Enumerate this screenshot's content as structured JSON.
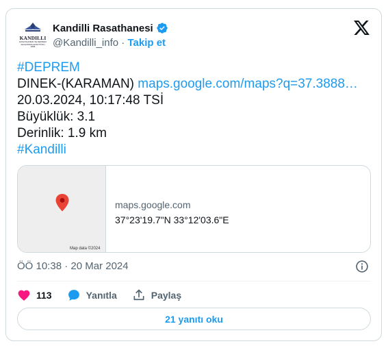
{
  "author": {
    "name": "Kandilli Rasathanesi",
    "handle": "@Kandilli_info",
    "separator": "·",
    "follow_label": "Takip et",
    "avatar_logo_text": "KANDILLI",
    "avatar_logo_sub": "RASATHANESİ VE DEPREM ARAŞTIRMA ENSTİTÜSÜ 1868"
  },
  "tweet": {
    "hashtag1": "#DEPREM",
    "location": "DINEK-(KARAMAN)",
    "map_link": "maps.google.com/maps?q=37.3888…",
    "datetime": "20.03.2024, 10:17:48 TSİ",
    "magnitude": "Büyüklük: 3.1",
    "depth": "Derinlik: 1.9 km",
    "hashtag2": "#Kandilli"
  },
  "map_card": {
    "domain": "maps.google.com",
    "coordinates": "37°23'19.7\"N 33°12'03.6\"E",
    "credit": "Map data ©2024"
  },
  "timestamp": "ÖÖ 10:38 · 20 Mar 2024",
  "actions": {
    "likes": "113",
    "reply_label": "Yanıtla",
    "share_label": "Paylaş"
  },
  "replies_button": "21 yanıtı oku",
  "colors": {
    "accent": "#1d9bf0",
    "like": "#f91880",
    "text": "#0f1419",
    "muted": "#536471",
    "border": "#cfd9de"
  },
  "icons": [
    "verified-badge-icon",
    "x-logo-icon",
    "map-pin-icon",
    "info-icon",
    "heart-icon",
    "reply-bubble-icon",
    "share-icon"
  ]
}
